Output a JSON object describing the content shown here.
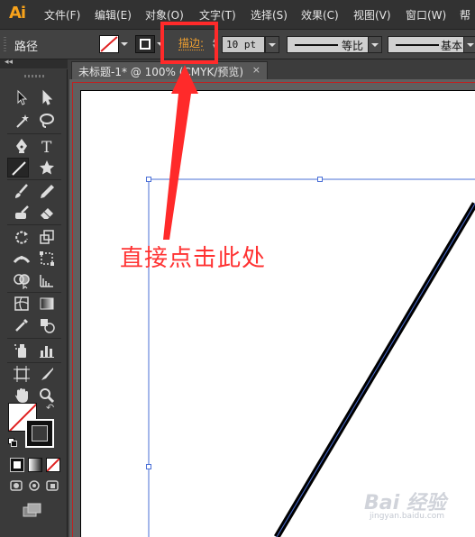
{
  "app": {
    "logo": "Ai"
  },
  "menu": [
    "文件(F)",
    "编辑(E)",
    "对象(O)",
    "文字(T)",
    "选择(S)",
    "效果(C)",
    "视图(V)",
    "窗口(W)",
    "帮"
  ],
  "control_bar": {
    "label": "路径",
    "stroke_label": "描边:",
    "stroke_weight": "10 pt",
    "variable_width_profile": "等比",
    "brush_definition": "基本"
  },
  "document": {
    "tab_title": "未标题-1* @ 100% (CMYK/预览)",
    "close_glyph": "×"
  },
  "tools": {
    "collapse_glyph": "◂◂",
    "swap_glyph": "↶"
  },
  "annotation": {
    "text": "直接点击此处",
    "color": "#ff2a2a"
  },
  "watermark": {
    "brand": "Bai 经验",
    "url": "jingyan.baidu.com"
  },
  "colors": {
    "accent_orange": "#f0a030",
    "selection_blue": "#4a6fd6",
    "none_red": "#e02020"
  }
}
